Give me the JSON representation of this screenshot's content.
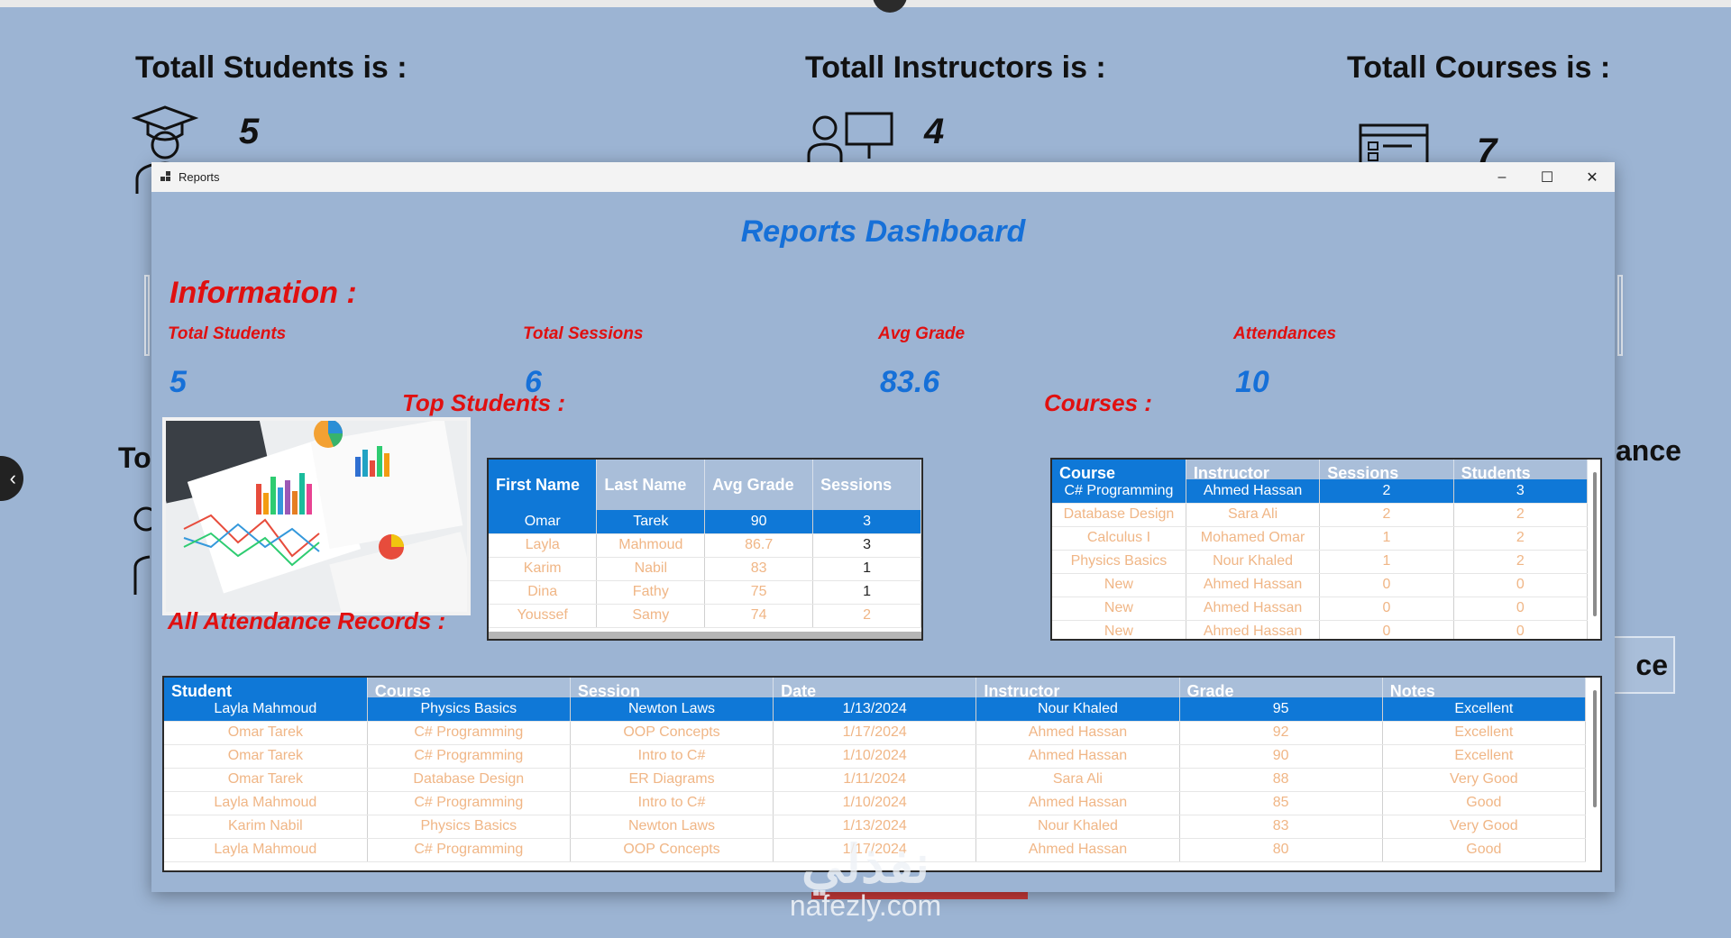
{
  "background": {
    "students": {
      "heading": "Totall Students is :",
      "value": "5"
    },
    "instructors": {
      "heading": "Totall Instructors is :",
      "value": "4"
    },
    "courses": {
      "heading": "Totall Courses is :",
      "value": "7"
    },
    "left_fragment": "To",
    "right_fragment": "ance",
    "button_fragment": "ce"
  },
  "window": {
    "title": "Reports",
    "controls": {
      "minimize": "–",
      "maximize": "☐",
      "close": "✕"
    }
  },
  "dashboard": {
    "title": "Reports Dashboard",
    "information_heading": "Information :",
    "stats": [
      {
        "label": "Total Students",
        "value": "5"
      },
      {
        "label": "Total Sessions",
        "value": "6"
      },
      {
        "label": "Avg Grade",
        "value": "83.6"
      },
      {
        "label": "Attendances",
        "value": "10"
      }
    ]
  },
  "top_students": {
    "heading": "Top Students :",
    "columns": [
      "First Name",
      "Last Name",
      "Avg Grade",
      "Sessions"
    ],
    "rows": [
      [
        "Omar",
        "Tarek",
        "90",
        "3"
      ],
      [
        "Layla",
        "Mahmoud",
        "86.7",
        "3"
      ],
      [
        "Karim",
        "Nabil",
        "83",
        "1"
      ],
      [
        "Dina",
        "Fathy",
        "75",
        "1"
      ],
      [
        "Youssef",
        "Samy",
        "74",
        "2"
      ]
    ]
  },
  "courses": {
    "heading": "Courses :",
    "columns": [
      "Course",
      "Instructor",
      "Sessions",
      "Students"
    ],
    "rows": [
      [
        "C# Programming",
        "Ahmed Hassan",
        "2",
        "3"
      ],
      [
        "Database Design",
        "Sara Ali",
        "2",
        "2"
      ],
      [
        "Calculus I",
        "Mohamed Omar",
        "1",
        "2"
      ],
      [
        "Physics Basics",
        "Nour Khaled",
        "1",
        "2"
      ],
      [
        "New",
        "Ahmed Hassan",
        "0",
        "0"
      ],
      [
        "New",
        "Ahmed Hassan",
        "0",
        "0"
      ],
      [
        "New",
        "Ahmed Hassan",
        "0",
        "0"
      ]
    ]
  },
  "attendance": {
    "heading": "All Attendance Records :",
    "columns": [
      "Student",
      "Course",
      "Session",
      "Date",
      "Instructor",
      "Grade",
      "Notes"
    ],
    "rows": [
      [
        "Layla Mahmoud",
        "Physics Basics",
        "Newton Laws",
        "1/13/2024",
        "Nour Khaled",
        "95",
        "Excellent"
      ],
      [
        "Omar Tarek",
        "C# Programming",
        "OOP Concepts",
        "1/17/2024",
        "Ahmed Hassan",
        "92",
        "Excellent"
      ],
      [
        "Omar Tarek",
        "C# Programming",
        "Intro to C#",
        "1/10/2024",
        "Ahmed Hassan",
        "90",
        "Excellent"
      ],
      [
        "Omar Tarek",
        "Database Design",
        "ER Diagrams",
        "1/11/2024",
        "Sara Ali",
        "88",
        "Very Good"
      ],
      [
        "Layla Mahmoud",
        "C# Programming",
        "Intro to C#",
        "1/10/2024",
        "Ahmed Hassan",
        "85",
        "Good"
      ],
      [
        "Karim Nabil",
        "Physics Basics",
        "Newton Laws",
        "1/13/2024",
        "Nour Khaled",
        "83",
        "Very Good"
      ],
      [
        "Layla Mahmoud",
        "C# Programming",
        "OOP Concepts",
        "1/17/2024",
        "Ahmed Hassan",
        "80",
        "Good"
      ]
    ]
  },
  "watermark": {
    "arabic": "نفذلي",
    "latin": "nafezly.com"
  },
  "colors": {
    "accent_blue": "#1670d8",
    "heading_red": "#e01010",
    "selection": "#0f78d7",
    "background": "#9cb4d3"
  }
}
